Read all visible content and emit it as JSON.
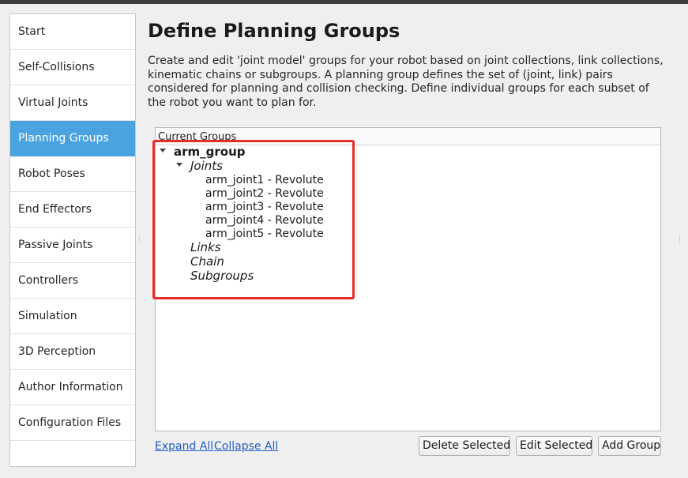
{
  "sidebar": {
    "items": [
      {
        "label": "Start"
      },
      {
        "label": "Self-Collisions"
      },
      {
        "label": "Virtual Joints"
      },
      {
        "label": "Planning Groups"
      },
      {
        "label": "Robot Poses"
      },
      {
        "label": "End Effectors"
      },
      {
        "label": "Passive Joints"
      },
      {
        "label": "Controllers"
      },
      {
        "label": "Simulation"
      },
      {
        "label": "3D Perception"
      },
      {
        "label": "Author Information"
      },
      {
        "label": "Configuration Files"
      }
    ],
    "active_index": 3
  },
  "main": {
    "title": "Define Planning Groups",
    "description": "Create and edit 'joint model' groups for your robot based on joint collections, link collections, kinematic chains or subgroups. A planning group defines the set of (joint, link) pairs considered for planning and collision checking. Define individual groups for each subset of the robot you want to plan for.",
    "groups_header": "Current Groups",
    "tree": {
      "group": "arm_group",
      "joints_label": "Joints",
      "joints": [
        "arm_joint1 - Revolute",
        "arm_joint2 - Revolute",
        "arm_joint3 - Revolute",
        "arm_joint4 - Revolute",
        "arm_joint5 - Revolute"
      ],
      "links_label": "Links",
      "chain_label": "Chain",
      "subgroups_label": "Subgroups"
    }
  },
  "footer": {
    "expand_all": "Expand All",
    "collapse_all": "Collapse All",
    "delete_selected": "Delete Selected",
    "edit_selected": "Edit Selected",
    "add_group": "Add Group"
  },
  "colors": {
    "accent": "#4aa3df",
    "highlight_box": "#e5302a",
    "link": "#1f5fc4"
  }
}
